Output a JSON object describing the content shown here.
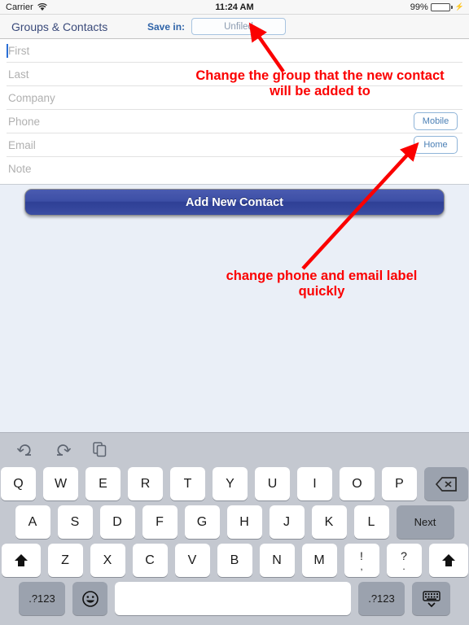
{
  "statusbar": {
    "carrier": "Carrier",
    "wifi_icon": "wifi-icon",
    "time": "11:24 AM",
    "battery_percent": "99%",
    "battery_icon": "battery-charging-icon"
  },
  "navbar": {
    "title": "Groups & Contacts",
    "save_in_label": "Save in:",
    "group_value": "Unfiled"
  },
  "form": {
    "fields": [
      {
        "placeholder": "First",
        "value": "",
        "label_button": null
      },
      {
        "placeholder": "Last",
        "value": "",
        "label_button": null
      },
      {
        "placeholder": "Company",
        "value": "",
        "label_button": null
      },
      {
        "placeholder": "Phone",
        "value": "",
        "label_button": "Mobile"
      },
      {
        "placeholder": "Email",
        "value": "",
        "label_button": "Home"
      },
      {
        "placeholder": "Note",
        "value": "",
        "label_button": null
      }
    ],
    "submit_label": "Add New Contact"
  },
  "annotations": [
    {
      "text": "Change the group that the new contact will be added to",
      "color": "#fb0000"
    },
    {
      "text": "change phone and email label quickly",
      "color": "#fb0000"
    }
  ],
  "keyboard": {
    "toolbar": [
      {
        "name": "undo-icon",
        "glyph": "undo"
      },
      {
        "name": "redo-icon",
        "glyph": "redo"
      },
      {
        "name": "copy-paste-icon",
        "glyph": "copy"
      }
    ],
    "row1": [
      "Q",
      "W",
      "E",
      "R",
      "T",
      "Y",
      "U",
      "I",
      "O",
      "P"
    ],
    "backspace": "backspace-icon",
    "row2": [
      "A",
      "S",
      "D",
      "F",
      "G",
      "H",
      "J",
      "K",
      "L"
    ],
    "next_key": "Next",
    "row3": [
      "Z",
      "X",
      "C",
      "V",
      "B",
      "N",
      "M"
    ],
    "shift_left": "shift-icon",
    "shift_right": "shift-icon",
    "dual_keys": [
      {
        "top": "!",
        "bottom": ","
      },
      {
        "top": "?",
        "bottom": "."
      }
    ],
    "numbers_left": ".?123",
    "emoji_key": "emoji-icon",
    "space_key": "",
    "numbers_right": ".?123",
    "hide_keyboard": "hide-keyboard-icon"
  },
  "colors": {
    "accent_blue": "#2e63a8",
    "nav_title": "#3a4a7a",
    "annotation_red": "#fb0000",
    "button_blue": "#3d4fa6",
    "page_bg": "#eaeff7",
    "keyboard_bg": "#c4c8d0",
    "battery_green": "#3ad53a"
  }
}
